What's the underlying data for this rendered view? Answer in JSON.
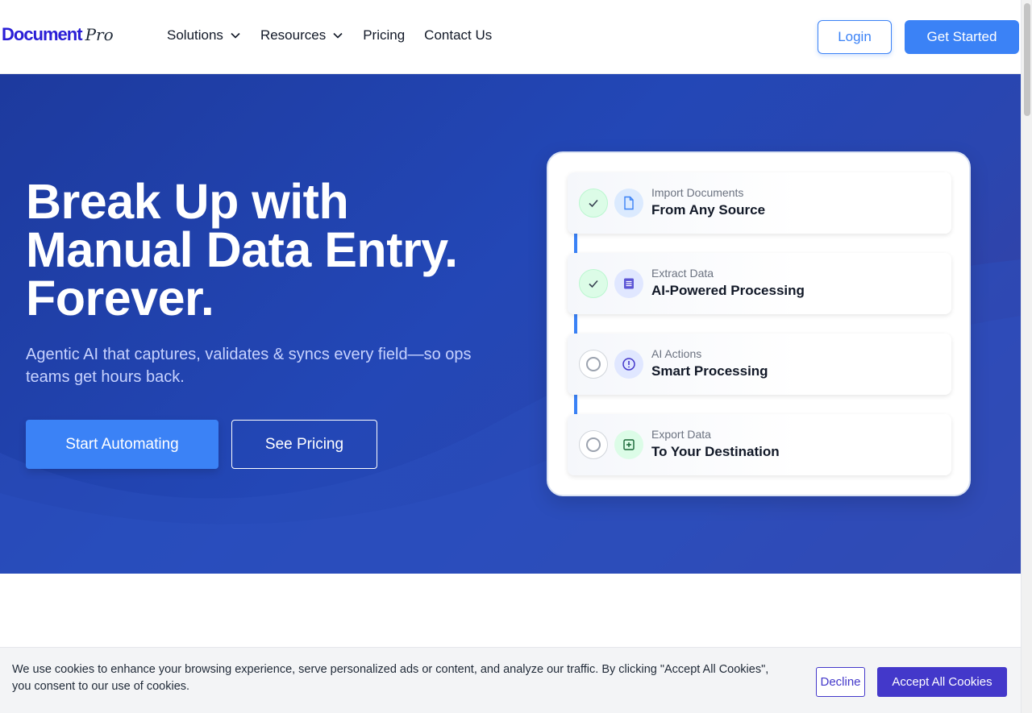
{
  "header": {
    "logo_main": "Document",
    "logo_pro": "Pro",
    "nav": [
      {
        "label": "Solutions",
        "has_dropdown": true
      },
      {
        "label": "Resources",
        "has_dropdown": true
      },
      {
        "label": "Pricing",
        "has_dropdown": false
      },
      {
        "label": "Contact Us",
        "has_dropdown": false
      }
    ],
    "login_label": "Login",
    "get_started_label": "Get Started"
  },
  "hero": {
    "title_line1": "Break Up with",
    "title_line2": "Manual Data Entry.",
    "title_line3": "Forever.",
    "subtitle": "Agentic AI that captures, validates & syncs every field—so ops teams get hours back.",
    "primary_cta": "Start Automating",
    "secondary_cta": "See Pricing"
  },
  "workflow": {
    "steps": [
      {
        "label": "Import Documents",
        "title": "From Any Source",
        "status": "done",
        "icon": "document-icon"
      },
      {
        "label": "Extract Data",
        "title": "AI-Powered Processing",
        "status": "done",
        "icon": "list-icon"
      },
      {
        "label": "AI Actions",
        "title": "Smart Processing",
        "status": "pending",
        "icon": "alert-icon"
      },
      {
        "label": "Export Data",
        "title": "To Your Destination",
        "status": "pending",
        "icon": "plus-box-icon"
      }
    ]
  },
  "cookie": {
    "text": "We use cookies to enhance your browsing experience, serve personalized ads or content, and analyze our traffic. By clicking \"Accept All Cookies\", you consent to our use of cookies.",
    "decline_label": "Decline",
    "accept_label": "Accept All Cookies"
  },
  "colors": {
    "brand": "#2a1ed6",
    "primary": "#3b82f6",
    "hero_bg": "#2347b6",
    "cookie_accent": "#4338ca"
  }
}
